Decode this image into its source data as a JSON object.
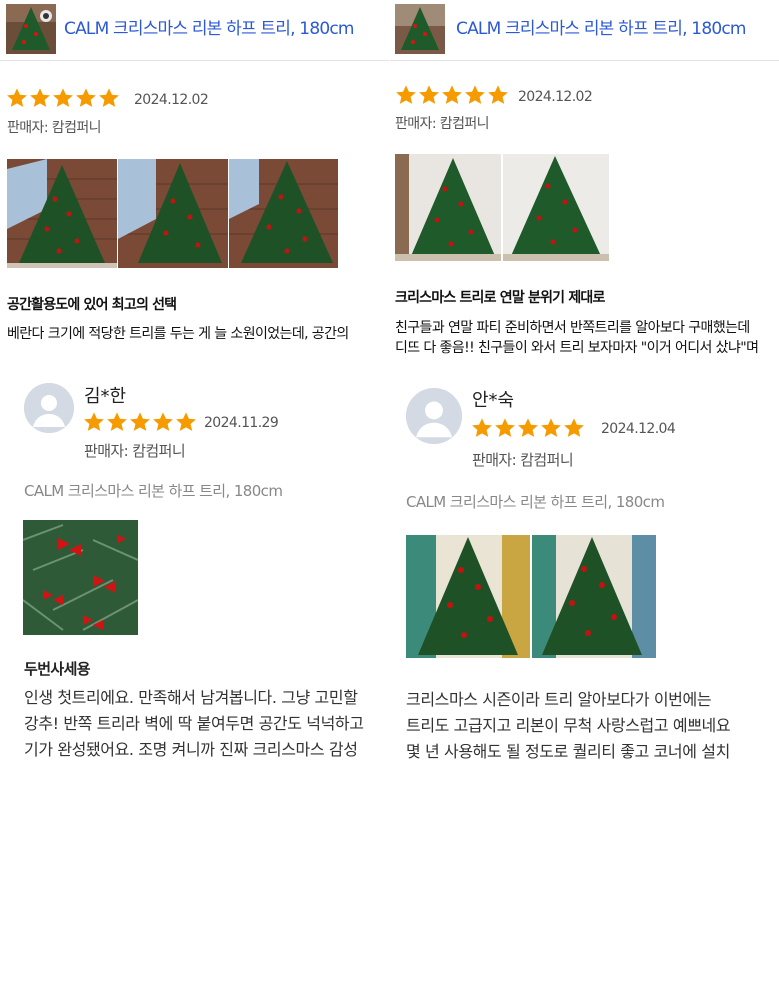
{
  "colors": {
    "link": "#2c59d6",
    "star": "#f59b00",
    "text": "#222222",
    "muted": "#888888",
    "avatar": "#d4dae3"
  },
  "icons": {
    "star": "star-icon",
    "avatar": "user-avatar-icon"
  },
  "left": {
    "header": {
      "product_title": "CALM 크리스마스 리본 하프 트리, 180cm"
    },
    "review1": {
      "rating": 5,
      "date": "2024.12.02",
      "seller": "판매자: 캄컴퍼니",
      "title": "공간활용도에 있어 최고의 선택",
      "text": "베란다 크기에 적당한 트리를 두는 게 늘 소원이었는데, 공간의"
    },
    "review2": {
      "reviewer": "김*한",
      "rating": 5,
      "date": "2024.11.29",
      "seller": "판매자: 캄컴퍼니",
      "product": "CALM 크리스마스 리본 하프 트리, 180cm",
      "subtitle": "두번사세용",
      "lines": [
        "인생 첫트리에요. 만족해서 남겨봅니다. 그냥 고민할",
        "강추! 반쪽 트리라 벽에 딱 붙여두면 공간도 넉넉하고",
        "기가 완성됐어요. 조명 켜니까 진짜 크리스마스 감성"
      ]
    }
  },
  "right": {
    "header": {
      "product_title": "CALM 크리스마스 리본 하프 트리, 180cm"
    },
    "review1": {
      "rating": 5,
      "date": "2024.12.02",
      "seller": "판매자: 캄컴퍼니",
      "title": "크리스마스 트리로 연말 분위기 제대로",
      "lines": [
        "친구들과 연말 파티 준비하면서 반쪽트리를 알아보다 구매했는데",
        "디뜨 다 좋음!! 친구들이 와서 트리 보자마자 \"이거 어디서 샀냐\"며"
      ]
    },
    "review2": {
      "reviewer": "안*숙",
      "rating": 5,
      "date": "2024.12.04",
      "seller": "판매자: 캄컴퍼니",
      "product": "CALM 크리스마스 리본 하프 트리, 180cm",
      "lines": [
        "크리스마스 시즌이라 트리 알아보다가 이번에는",
        "트리도 고급지고 리본이 무척 사랑스럽고 예쁘네요",
        "몇 년 사용해도 될 정도로 퀄리티 좋고 코너에 설치"
      ]
    }
  }
}
